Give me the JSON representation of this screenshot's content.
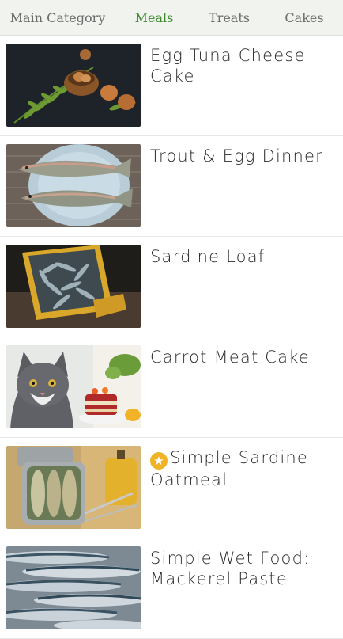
{
  "tabs": [
    {
      "label": "Main Category",
      "active": false
    },
    {
      "label": "Meals",
      "active": true
    },
    {
      "label": "Treats",
      "active": false
    },
    {
      "label": "Cakes",
      "active": false
    }
  ],
  "colors": {
    "accent": "#3e8a2e",
    "star": "#f0b323"
  },
  "recipes": [
    {
      "title": "Egg Tuna Cheese Cake",
      "image": "eggs-fern-photo",
      "starred": false
    },
    {
      "title": "Trout & Egg Dinner",
      "image": "trout-plate-photo",
      "starred": false
    },
    {
      "title": "Sardine Loaf",
      "image": "sardine-crate-photo",
      "starred": false
    },
    {
      "title": "Carrot Meat Cake",
      "image": "cat-cake-photo",
      "starred": false
    },
    {
      "title": "Simple Sardine Oatmeal",
      "image": "canned-sardines-photo",
      "starred": true,
      "badge_icon": "star-icon"
    },
    {
      "title": "Simple Wet Food: Mackerel Paste",
      "image": "mackerel-photo",
      "starred": false
    }
  ]
}
